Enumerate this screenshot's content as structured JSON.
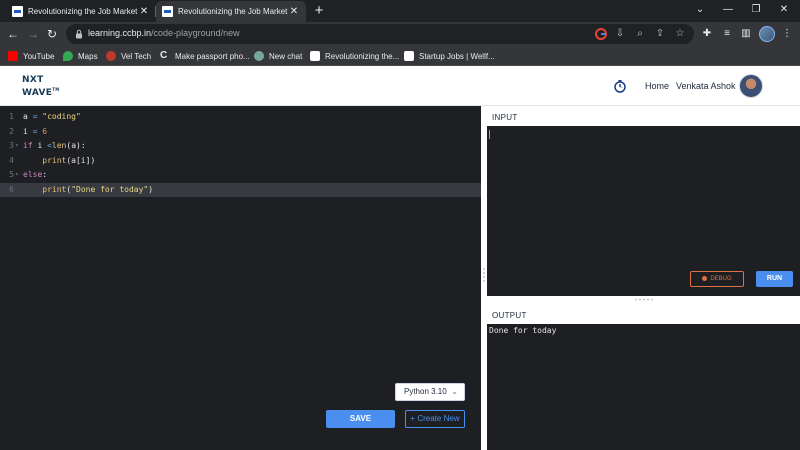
{
  "browser": {
    "tabs": [
      {
        "title": "Revolutionizing the Job Market |",
        "active": false
      },
      {
        "title": "Revolutionizing the Job Market |",
        "active": true
      }
    ],
    "url_host": "learning.ccbp.in",
    "url_path": "/code-playground/new",
    "bookmarks": [
      {
        "label": "YouTube",
        "icon": "youtube-icon",
        "color": "#ff0000"
      },
      {
        "label": "Maps",
        "icon": "maps-icon",
        "color": "#34a853"
      },
      {
        "label": "Vel Tech",
        "icon": "veltech-icon",
        "color": "#c0392b"
      },
      {
        "label": "Make passport pho...",
        "icon": "c-logo-icon",
        "color": "#e8eaed"
      },
      {
        "label": "New chat",
        "icon": "chatgpt-icon",
        "color": "#74aa9c"
      },
      {
        "label": "Revolutionizing the...",
        "icon": "nxtwave-icon",
        "color": "#ffffff"
      },
      {
        "label": "Startup Jobs | Wellf...",
        "icon": "wellfound-icon",
        "color": "#ffffff"
      }
    ]
  },
  "header": {
    "logo_line1": "NXT",
    "logo_line2": "WAVE",
    "logo_tm": "TM",
    "home": "Home",
    "user_name": "Venkata Ashok"
  },
  "editor": {
    "lines": [
      {
        "n": "1",
        "tokens": [
          [
            "var",
            "a"
          ],
          [
            "op",
            " = "
          ],
          [
            "str",
            "\"coding\""
          ]
        ]
      },
      {
        "n": "2",
        "tokens": [
          [
            "var",
            "i"
          ],
          [
            "op",
            " = "
          ],
          [
            "num",
            "6"
          ]
        ]
      },
      {
        "n": "3",
        "tokens": [
          [
            "kw",
            "if"
          ],
          [
            "var",
            " i "
          ],
          [
            "op",
            "<"
          ],
          [
            "fn",
            "len"
          ],
          [
            "var",
            "(a):"
          ]
        ],
        "fold": true
      },
      {
        "n": "4",
        "tokens": [
          [
            "var",
            "    "
          ],
          [
            "fn",
            "print"
          ],
          [
            "var",
            "(a[i])"
          ]
        ]
      },
      {
        "n": "5",
        "tokens": [
          [
            "kw",
            "else"
          ],
          [
            "var",
            ":"
          ]
        ],
        "fold": true
      },
      {
        "n": "6",
        "tokens": [
          [
            "var",
            "    "
          ],
          [
            "fn",
            "print"
          ],
          [
            "var",
            "("
          ],
          [
            "str",
            "\"Done for today\""
          ],
          [
            "var",
            ")"
          ]
        ],
        "active": true
      }
    ],
    "language": "Python 3.10",
    "save_label": "SAVE",
    "create_label": "Create New"
  },
  "input_panel": {
    "title": "INPUT",
    "debug_label": "DEBUG",
    "run_label": "RUN"
  },
  "output_panel": {
    "title": "OUTPUT",
    "text": "Done for today"
  },
  "colors": {
    "accent": "#4a8ef0",
    "debug": "#d97346",
    "editor_bg": "#1e1f22"
  }
}
